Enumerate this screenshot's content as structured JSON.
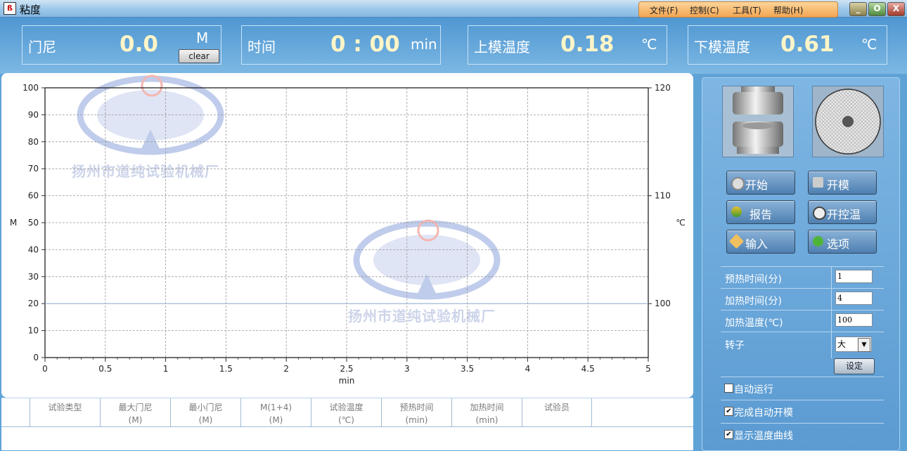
{
  "window": {
    "title": "粘度",
    "icon": "app-logo-icon"
  },
  "menu": [
    "文件(F)",
    "控制(C)",
    "工具(T)",
    "帮助(H)"
  ],
  "window_buttons": {
    "minimize": "_",
    "maximize": "O",
    "close": "X"
  },
  "readouts": {
    "mooney": {
      "label": "门尼",
      "value": "0.0",
      "unit": "M",
      "clear": "clear"
    },
    "time": {
      "label": "时间",
      "value": "0 : 00",
      "unit": "min"
    },
    "upper_temp": {
      "label": "上模温度",
      "value": "0.18",
      "unit": "℃"
    },
    "lower_temp": {
      "label": "下模温度",
      "value": "0.61",
      "unit": "℃"
    }
  },
  "watermark": {
    "text": "扬州市道纯试验机械厂"
  },
  "chart_data": {
    "type": "line",
    "xlabel": "min",
    "ylabel": "M",
    "y2label": "℃",
    "xlim": [
      0,
      5
    ],
    "ylim": [
      0,
      100
    ],
    "y2lim": [
      95,
      120
    ],
    "x_ticks": [
      "0",
      "0.5",
      "1",
      "1.5",
      "2",
      "2.5",
      "3",
      "3.5",
      "4",
      "4.5",
      "5"
    ],
    "y_ticks": [
      "0",
      "10",
      "20",
      "30",
      "40",
      "50",
      "60",
      "70",
      "80",
      "90",
      "100"
    ],
    "y2_ticks": [
      "100",
      "110",
      "120"
    ],
    "grid": true,
    "series": [
      {
        "axis": "y2",
        "color": "#9ab6d8",
        "x": [
          0,
          5
        ],
        "values": [
          100,
          100
        ]
      }
    ]
  },
  "buttons": {
    "start": "开始",
    "open_mold": "开模",
    "report": "报告",
    "temp_control": "开控温",
    "input": "输入",
    "options": "选项"
  },
  "params": {
    "preheat_label": "预热时间(分)",
    "preheat_value": "1",
    "heat_time_label": "加热时间(分)",
    "heat_time_value": "4",
    "heat_temp_label": "加热温度(℃)",
    "heat_temp_value": "100",
    "rotor_label": "转子",
    "rotor_value": "大",
    "set_button": "设定"
  },
  "checks": [
    {
      "label": "自动运行",
      "checked": false
    },
    {
      "label": "完成自动开模",
      "checked": true
    },
    {
      "label": "显示温度曲线",
      "checked": true
    }
  ],
  "table": {
    "headers": [
      {
        "l1": "试验类型",
        "l2": ""
      },
      {
        "l1": "最大门尼",
        "l2": "(M)"
      },
      {
        "l1": "最小门尼",
        "l2": "(M)"
      },
      {
        "l1": "M(1+4)",
        "l2": "(M)"
      },
      {
        "l1": "试验温度",
        "l2": "(℃)"
      },
      {
        "l1": "预热时间",
        "l2": "(min)"
      },
      {
        "l1": "加热时间",
        "l2": "(min)"
      },
      {
        "l1": "试验员",
        "l2": ""
      }
    ]
  }
}
